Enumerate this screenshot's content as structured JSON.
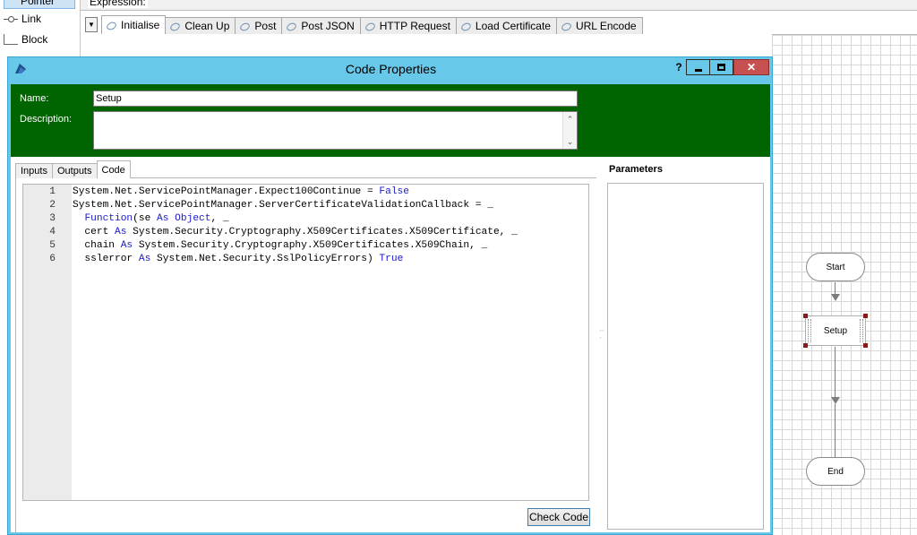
{
  "toolbox": {
    "items": [
      {
        "label": "Pointer"
      },
      {
        "label": "Link"
      },
      {
        "label": "Block"
      }
    ]
  },
  "expression": {
    "label": "Expression:"
  },
  "page_tabs": [
    {
      "label": "Initialise",
      "active": true
    },
    {
      "label": "Clean Up"
    },
    {
      "label": "Post"
    },
    {
      "label": "Post JSON"
    },
    {
      "label": "HTTP Request"
    },
    {
      "label": "Load Certificate"
    },
    {
      "label": "URL Encode"
    }
  ],
  "flow": {
    "start": "Start",
    "setup": "Setup",
    "end": "End"
  },
  "dialog": {
    "title": "Code Properties",
    "help_label": "?",
    "name_label": "Name:",
    "name_value": "Setup",
    "description_label": "Description:",
    "description_value": "",
    "tabs": [
      {
        "label": "Inputs"
      },
      {
        "label": "Outputs"
      },
      {
        "label": "Code",
        "active": true
      }
    ],
    "parameters_title": "Parameters",
    "check_code_label": "Check Code",
    "accent_color": "#67c8e9",
    "header_color": "#006400",
    "code_lines": [
      {
        "num": "1",
        "segments": [
          {
            "t": "System.Net.ServicePointManager.Expect100Continue = "
          },
          {
            "t": "False",
            "kw": true
          }
        ]
      },
      {
        "num": "2",
        "segments": [
          {
            "t": "System.Net.ServicePointManager.ServerCertificateValidationCallback = _"
          }
        ]
      },
      {
        "num": "3",
        "segments": [
          {
            "t": "  "
          },
          {
            "t": "Function",
            "kw": true
          },
          {
            "t": "(se "
          },
          {
            "t": "As",
            "kw": true
          },
          {
            "t": " "
          },
          {
            "t": "Object",
            "kw": true
          },
          {
            "t": ", _"
          }
        ]
      },
      {
        "num": "4",
        "segments": [
          {
            "t": "  cert "
          },
          {
            "t": "As",
            "kw": true
          },
          {
            "t": " System.Security.Cryptography.X509Certificates.X509Certificate, _"
          }
        ]
      },
      {
        "num": "5",
        "segments": [
          {
            "t": "  chain "
          },
          {
            "t": "As",
            "kw": true
          },
          {
            "t": " System.Security.Cryptography.X509Certificates.X509Chain, _"
          }
        ]
      },
      {
        "num": "6",
        "segments": [
          {
            "t": "  sslerror "
          },
          {
            "t": "As",
            "kw": true
          },
          {
            "t": " System.Net.Security.SslPolicyErrors) "
          },
          {
            "t": "True",
            "kw": true
          }
        ]
      }
    ]
  }
}
